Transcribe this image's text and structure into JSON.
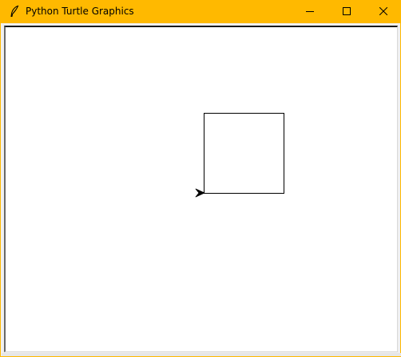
{
  "window": {
    "title": "Python Turtle Graphics",
    "accent_color": "#ffb900",
    "app_icon": "feather-icon"
  },
  "controls": {
    "minimize_icon": "minimize-icon",
    "maximize_icon": "maximize-icon",
    "close_icon": "close-icon"
  },
  "canvas": {
    "background": "#ffffff",
    "square": {
      "stroke": "#000000",
      "side": 100
    },
    "turtle": {
      "shape": "arrow-classic",
      "heading_deg": 0,
      "color": "#000000",
      "position": [
        0,
        0
      ]
    }
  }
}
